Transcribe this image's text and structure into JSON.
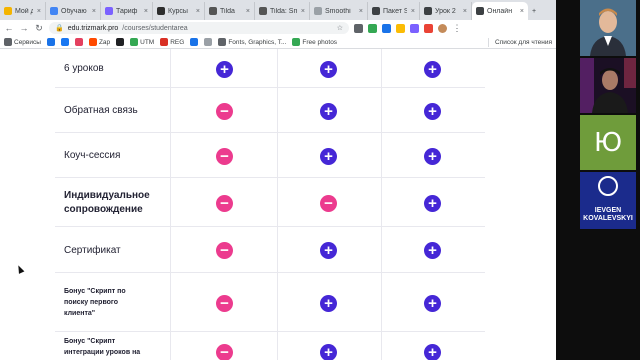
{
  "browser": {
    "tabs": [
      {
        "title": "Мой дис",
        "favicon": "drive-icon",
        "color": "#f4b400",
        "active": false
      },
      {
        "title": "Обучаю",
        "favicon": "page-icon",
        "color": "#4285f4",
        "active": false
      },
      {
        "title": "Тариф",
        "favicon": "page-icon",
        "color": "#7b61ff",
        "active": false
      },
      {
        "title": "Курсы",
        "favicon": "page-icon",
        "color": "#2d2d2d",
        "active": false
      },
      {
        "title": "Tilda",
        "favicon": "tilda-icon",
        "color": "#555555",
        "active": false
      },
      {
        "title": "Tilda: Sm",
        "favicon": "tilda-icon",
        "color": "#555555",
        "active": false
      },
      {
        "title": "Smoothi",
        "favicon": "page-icon",
        "color": "#9aa0a6",
        "active": false
      },
      {
        "title": "Пакет S",
        "favicon": "page-icon",
        "color": "#3c4043",
        "active": false
      },
      {
        "title": "Урок 2",
        "favicon": "page-icon",
        "color": "#3c4043",
        "active": false
      },
      {
        "title": "Онлайн",
        "favicon": "page-icon",
        "color": "#3c4043",
        "active": true
      }
    ],
    "url_host": "edu.trizmark.pro",
    "url_path": "/courses/studentarea",
    "bookmarks": [
      {
        "label": "Сервисы",
        "color": "#5f6368"
      },
      {
        "label": "",
        "color": "#1a73e8"
      },
      {
        "label": "",
        "color": "#1877f2"
      },
      {
        "label": "",
        "color": "#e4405f"
      },
      {
        "label": "Zap",
        "color": "#ff4a00"
      },
      {
        "label": "",
        "color": "#202124"
      },
      {
        "label": "UTM",
        "color": "#34a853"
      },
      {
        "label": "REG",
        "color": "#d93025"
      },
      {
        "label": "",
        "color": "#1a73e8"
      },
      {
        "label": "",
        "color": "#9aa0a6"
      },
      {
        "label": "Fonts, Graphics, T...",
        "color": "#5f6368"
      },
      {
        "label": "Free photos",
        "color": "#34a853"
      }
    ],
    "reading_list": "Список для чтения"
  },
  "colors": {
    "plus": "#4527d6",
    "minus": "#ec3b8e",
    "divider": "#e8e8ee"
  },
  "table": {
    "rows": [
      {
        "label": "6 уроков",
        "style": "normal",
        "cells": [
          "plus",
          "plus",
          "plus"
        ]
      },
      {
        "label": "Обратная связь",
        "style": "normal",
        "cells": [
          "minus",
          "plus",
          "plus"
        ]
      },
      {
        "label": "Коуч-сессия",
        "style": "normal",
        "cells": [
          "minus",
          "plus",
          "plus"
        ]
      },
      {
        "label": "Индивидуальное сопровождение",
        "style": "bold",
        "cells": [
          "minus",
          "minus",
          "plus"
        ]
      },
      {
        "label": "Сертификат",
        "style": "normal",
        "cells": [
          "minus",
          "plus",
          "plus"
        ]
      },
      {
        "label": "Бонус \"Скрипт по поиску первого клиента\"",
        "style": "small",
        "cells": [
          "minus",
          "plus",
          "plus"
        ]
      },
      {
        "label": "Бонус \"Скрипт интеграции уроков на",
        "style": "small",
        "cells": [
          "minus",
          "plus",
          "plus"
        ]
      }
    ]
  },
  "video": {
    "tiles": [
      {
        "name": "participant-camera-man-suit"
      },
      {
        "name": "participant-camera-man-cap"
      },
      {
        "initial": "Ю"
      },
      {
        "logo_line1": "IEVGEN",
        "logo_line2": "KOVALEVSKYI"
      }
    ]
  }
}
